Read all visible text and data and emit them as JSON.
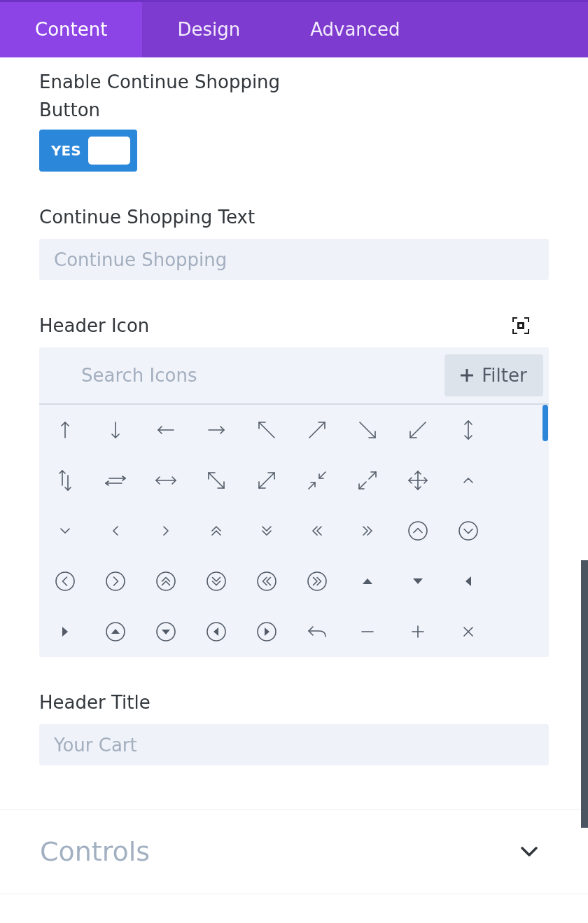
{
  "tabs": [
    {
      "label": "Content",
      "selected": true
    },
    {
      "label": "Design",
      "selected": false
    },
    {
      "label": "Advanced",
      "selected": false
    }
  ],
  "fields": [
    {
      "kind": "toggle",
      "label": "Enable Continue Shopping Button",
      "on": true,
      "value_label": "YES"
    },
    {
      "kind": "text",
      "label": "Continue Shopping Text",
      "placeholder": "Continue Shopping"
    },
    {
      "kind": "icon_picker",
      "label": "Header Icon",
      "search": {
        "placeholder": "Search Icons"
      },
      "filter_button": "Filter"
    },
    {
      "kind": "text",
      "label": "Header Title",
      "placeholder": "Your Cart"
    }
  ],
  "sections": [
    {
      "title": "Controls",
      "expanded": false
    }
  ]
}
